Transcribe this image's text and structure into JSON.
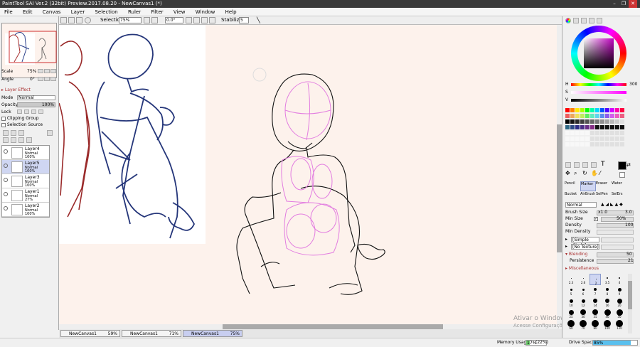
{
  "window": {
    "title": "PaintTool SAI Ver.2 (32bit) Preview.2017.08.20 - NewCanvas1 (*)",
    "minimize": "–",
    "maximize": "❐",
    "close": "✕"
  },
  "menu": [
    "File",
    "Edit",
    "Canvas",
    "Layer",
    "Selection",
    "Ruler",
    "Filter",
    "View",
    "Window",
    "Help"
  ],
  "toolbar": {
    "selection_label": "Selection",
    "zoom": "75%",
    "rotation": "0.0°",
    "stabilizer_label": "Stabilizer",
    "stabilizer_value": "5"
  },
  "left": {
    "scale_label": "Scale",
    "scale_value": "75%",
    "angle_label": "Angle",
    "angle_value": "0°",
    "layer_effect": "Layer Effect",
    "mode_label": "Mode",
    "mode_value": "Normal",
    "opacity_label": "Opacity",
    "opacity_value": "100%",
    "lock_label": "Lock",
    "clipping_group": "Clipping Group",
    "selection_source": "Selection Source",
    "layers": [
      {
        "name": "Layer4",
        "mode": "Normal",
        "opacity": "100%",
        "selected": false
      },
      {
        "name": "Layer5",
        "mode": "Normal",
        "opacity": "100%",
        "selected": true
      },
      {
        "name": "Layer3",
        "mode": "Normal",
        "opacity": "100%",
        "selected": false
      },
      {
        "name": "Layer1",
        "mode": "Normal",
        "opacity": "27%",
        "selected": false
      },
      {
        "name": "Layer2",
        "mode": "Normal",
        "opacity": "100%",
        "selected": false
      }
    ]
  },
  "tabs": [
    {
      "name": "NewCanvas1",
      "zoom": "59%"
    },
    {
      "name": "NewCanvas1",
      "zoom": "71%"
    },
    {
      "name": "NewCanvas1",
      "zoom": "75%"
    }
  ],
  "status": {
    "memory_label": "Memory Usage",
    "memory_value": "17%",
    "memory_detail": "(22%)",
    "drive_label": "Drive Space",
    "drive_value": "85%",
    "memory_fraction": 0.17,
    "drive_fraction": 0.85
  },
  "watermark": {
    "line1": "Ativar o Windows",
    "line2": "Acesse Configurações"
  },
  "right": {
    "h_label": "H",
    "h_value": "300",
    "s_label": "S",
    "v_label": "V",
    "tools": [
      {
        "label": "Pencil",
        "name": "pencil-tool"
      },
      {
        "label": "Marker",
        "name": "marker-tool"
      },
      {
        "label": "Eraser",
        "name": "eraser-tool"
      },
      {
        "label": "Water",
        "name": "water-tool"
      },
      {
        "label": "Bucket",
        "name": "bucket-tool"
      },
      {
        "label": "AirBrush",
        "name": "airbrush-tool"
      },
      {
        "label": "SelPen",
        "name": "selpen-tool"
      },
      {
        "label": "SelErs",
        "name": "selers-tool"
      }
    ],
    "blend_mode": "Normal",
    "brush_size_label": "Brush Size",
    "brush_size_mult": "x1.0",
    "brush_size_value": "3.0",
    "min_size_label": "Min Size",
    "min_size_value": "50%",
    "density_label": "Density",
    "density_value": "100",
    "min_density_label": "Min Density",
    "shape_value": "[Simple Circle]",
    "texture_value": "[No Texture]",
    "blending_label": "Blending",
    "blending_value": "50",
    "persistence_label": "Persistence",
    "persistence_value": "21",
    "misc_label": "Miscellaneous",
    "brush_sizes": [
      "2.3",
      "2.6",
      "2",
      "3.5",
      "4",
      "5",
      "6",
      "7",
      "8",
      "9",
      "10",
      "12",
      "14",
      "16",
      "20",
      "25",
      "30",
      "35",
      "40",
      "50",
      "60",
      "70",
      "80",
      "100",
      "120"
    ]
  }
}
